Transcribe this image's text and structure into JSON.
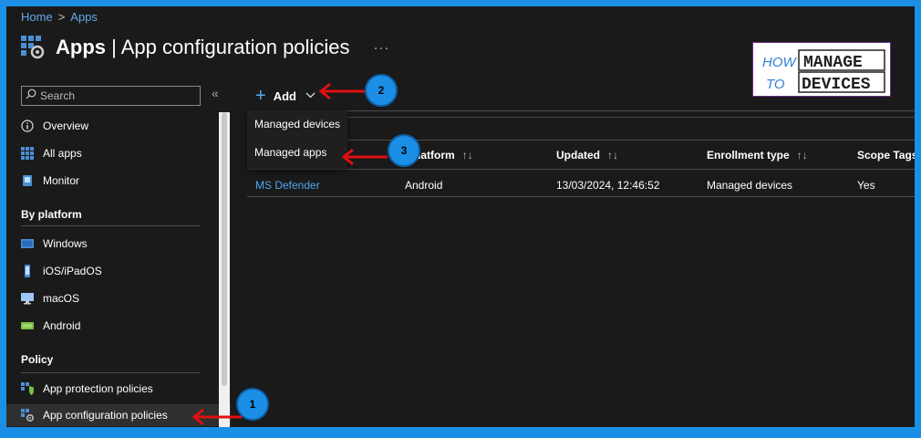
{
  "breadcrumb": {
    "home": "Home",
    "separator": ">",
    "current": "Apps"
  },
  "header": {
    "title_bold": "Apps",
    "title_rest": " | App configuration policies",
    "more": "···"
  },
  "logo": {
    "line1_a": "HOW",
    "line1_b": "MANAGE",
    "line2_a": "TO",
    "line2_b": "DEVICES"
  },
  "sidebar": {
    "search_placeholder": "Search",
    "collapse": "«",
    "items": [
      {
        "label": "Overview",
        "icon": "info-icon"
      },
      {
        "label": "All apps",
        "icon": "grid-icon"
      },
      {
        "label": "Monitor",
        "icon": "monitor-icon"
      }
    ],
    "platform_header": "By platform",
    "platforms": [
      {
        "label": "Windows",
        "icon": "windows-icon"
      },
      {
        "label": "iOS/iPadOS",
        "icon": "phone-icon"
      },
      {
        "label": "macOS",
        "icon": "mac-icon"
      },
      {
        "label": "Android",
        "icon": "android-icon"
      }
    ],
    "policy_header": "Policy",
    "policies": [
      {
        "label": "App protection policies",
        "icon": "shield-grid-icon"
      },
      {
        "label": "App configuration policies",
        "icon": "gear-grid-icon",
        "selected": true
      }
    ]
  },
  "toolbar": {
    "add_label": "Add",
    "add_icon": "plus-icon",
    "chevron": "chevron-down-icon"
  },
  "dropdown": {
    "items": [
      "Managed devices",
      "Managed apps"
    ]
  },
  "table": {
    "columns": [
      "Platform",
      "Updated",
      "Enrollment type",
      "Scope Tags"
    ],
    "sort_glyph": "↑↓",
    "rows": [
      {
        "name": "MS Defender",
        "platform": "Android",
        "updated": "13/03/2024, 12:46:52",
        "enrollment": "Managed devices",
        "scope": "Yes"
      }
    ]
  },
  "annotations": {
    "badge1": "1",
    "badge2": "2",
    "badge3": "3",
    "arrow_color": "#e01010",
    "badge_color": "#1b8fe6"
  },
  "colors": {
    "accent": "#1b8fe6",
    "link": "#4ea6f0",
    "background": "#1a1a1a"
  }
}
